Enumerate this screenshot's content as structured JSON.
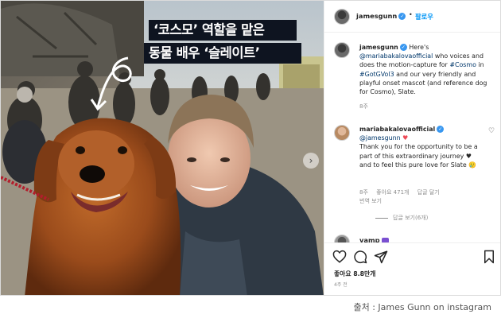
{
  "overlay": {
    "line1": "‘코스모’ 역할을 맡은",
    "line2": "동물 배우 ‘슬레이트’"
  },
  "header": {
    "username": "jamesgunn",
    "follow_label": "팔로우"
  },
  "caption": {
    "username": "jamesgunn",
    "text_a": "Here's",
    "mention": "@mariabakalovaofficial",
    "text_b": "who voices and does the motion-capture for",
    "hashtag1": "#Cosmo",
    "text_c": "in",
    "hashtag2": "#GotGVol3",
    "text_d": "and our very friendly and playful onset mascot (and reference dog for Cosmo), Slate.",
    "time": "8주"
  },
  "comment": {
    "username": "mariabakalovaofficial",
    "mention": "@jamesgunn",
    "text1": "Thank you for the opportunity to be a part of this extraordinary journey",
    "text2": "and to feel this pure love for Slate",
    "time": "8주",
    "likes": "좋아요 471개",
    "reply": "답글 달기",
    "translate": "번역 보기",
    "more_replies": "답글 보기(6개)"
  },
  "next_comment": {
    "username": "vamp"
  },
  "actions": {
    "likes_text": "좋아요 8.8만개",
    "time": "4주 전"
  },
  "source_credit": "출처 : James Gunn on instagram",
  "colors": {
    "link": "#00376b",
    "follow": "#0095f6",
    "verified": "#3897f0",
    "overlay_bg": "#0e1420"
  }
}
